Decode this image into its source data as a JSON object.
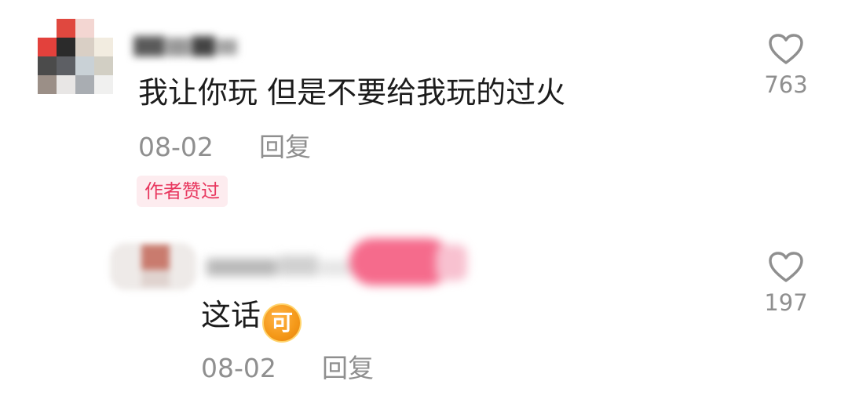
{
  "comment": {
    "text": "我让你玩 但是不要给我玩的过火",
    "date": "08-02",
    "reply_label": "回复",
    "author_liked_badge": "作者赞过",
    "like_count": "763",
    "like_icon": "heart-outline-icon"
  },
  "reply": {
    "text": "这话",
    "emoji_char": "可",
    "emoji_name": "ke-emoji-icon",
    "date": "08-02",
    "reply_label": "回复",
    "like_count": "197",
    "like_icon": "heart-outline-icon"
  },
  "colors": {
    "badge_text": "#e8385f",
    "badge_bg": "#fdecef",
    "meta_gray": "#8f8f8f",
    "emoji_orange": "#f59a1a"
  }
}
